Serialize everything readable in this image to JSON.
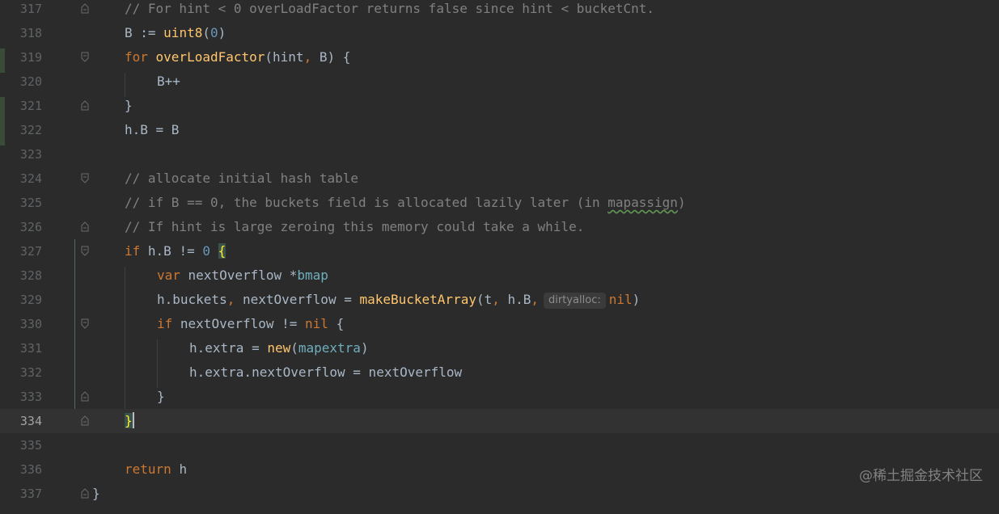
{
  "editor": {
    "line_numbers": [
      "317",
      "318",
      "319",
      "320",
      "321",
      "322",
      "323",
      "324",
      "325",
      "326",
      "327",
      "328",
      "329",
      "330",
      "331",
      "332",
      "333",
      "334",
      "335",
      "336",
      "337"
    ],
    "lines": {
      "l317": {
        "comment": "// For hint < 0 overLoadFactor returns false since hint < bucketCnt."
      },
      "l318": {
        "a": "B := ",
        "fn": "uint8",
        "b": "(",
        "num": "0",
        "c": ")"
      },
      "l319": {
        "kw": "for ",
        "fn": "overLoadFactor",
        "a": "(hint",
        "comma": ",",
        "b": " B) {"
      },
      "l320": {
        "text": "B++"
      },
      "l321": {
        "text": "}"
      },
      "l322": {
        "text": "h.B = B"
      },
      "l324": {
        "comment": "// allocate initial hash table"
      },
      "l325": {
        "comment_a": "// if B == 0, the buckets field is allocated lazily later (in ",
        "comment_w": "mapassign",
        "comment_b": ")"
      },
      "l326": {
        "comment": "// If hint is large zeroing this memory could take a while."
      },
      "l327": {
        "kw": "if ",
        "a": "h.B != ",
        "num": "0",
        "b": " ",
        "brace": "{"
      },
      "l328": {
        "kw": "var ",
        "a": "nextOverflow *",
        "ty": "bmap"
      },
      "l329": {
        "a": "h.buckets",
        "comma1": ",",
        "b": " nextOverflow = ",
        "fn": "makeBucketArray",
        "c": "(t",
        "comma2": ",",
        "d": " h.B",
        "comma3": ",",
        "hint": "dirtyalloc:",
        "kw": "nil",
        "e": ")"
      },
      "l330": {
        "kw": "if ",
        "a": "nextOverflow != ",
        "kw2": "nil",
        "b": " {"
      },
      "l331": {
        "a": "h.extra = ",
        "fn": "new",
        "b": "(",
        "ty": "mapextra",
        "c": ")"
      },
      "l332": {
        "text": "h.extra.nextOverflow = nextOverflow"
      },
      "l333": {
        "text": "}"
      },
      "l334": {
        "brace": "}"
      },
      "l336": {
        "kw": "return ",
        "a": "h"
      },
      "l337": {
        "text": "}"
      }
    },
    "current_line": "334"
  },
  "watermark": "@稀土掘金技术社区",
  "colors": {
    "background": "#2b2b2b",
    "keyword": "#cc7832",
    "comment": "#808080",
    "number": "#6897bb",
    "function": "#ffc66d",
    "type": "#6fafbd",
    "text": "#a9b7c6",
    "line_number": "#606366"
  }
}
